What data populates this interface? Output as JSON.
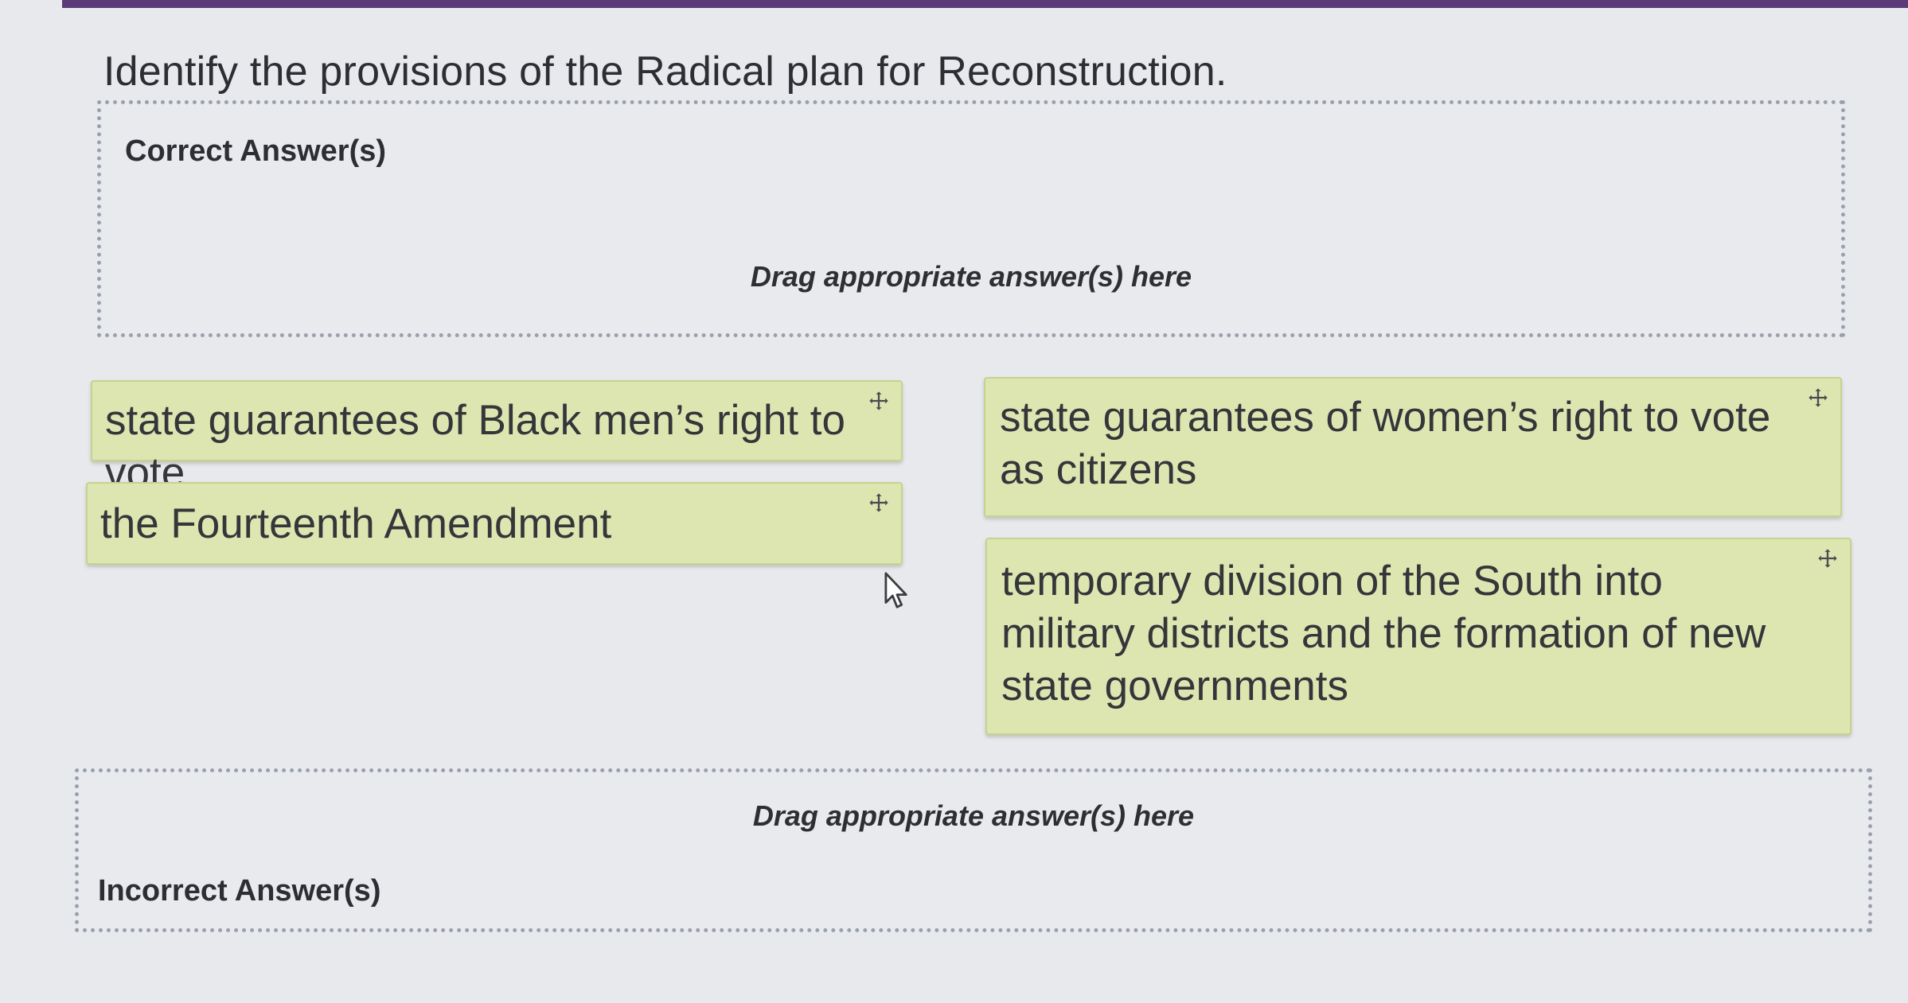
{
  "question": {
    "text": "Identify the provisions of the Radical plan for Reconstruction."
  },
  "correct_zone": {
    "title": "Correct Answer(s)",
    "hint": "Drag appropriate answer(s) here"
  },
  "incorrect_zone": {
    "title": "Incorrect Answer(s)",
    "hint": "Drag appropriate answer(s) here"
  },
  "answer_cards": [
    {
      "text": "state guarantees of Black men’s right to vote",
      "icon": "move-icon"
    },
    {
      "text": "state guarantees of women’s right to vote as citizens",
      "icon": "move-icon"
    },
    {
      "text": "the Fourteenth Amendment",
      "icon": "move-icon"
    },
    {
      "text": "temporary division of the South into military districts and the formation of new state governments",
      "icon": "move-icon"
    }
  ],
  "colors": {
    "page_background": "#e7e9ed",
    "accent_bar": "#5c3a79",
    "card_background": "#dde6b1",
    "card_border": "#c7d28f",
    "dropzone_border": "#9aa1ab"
  },
  "cursor": {
    "icon": "arrow-cursor-icon"
  }
}
